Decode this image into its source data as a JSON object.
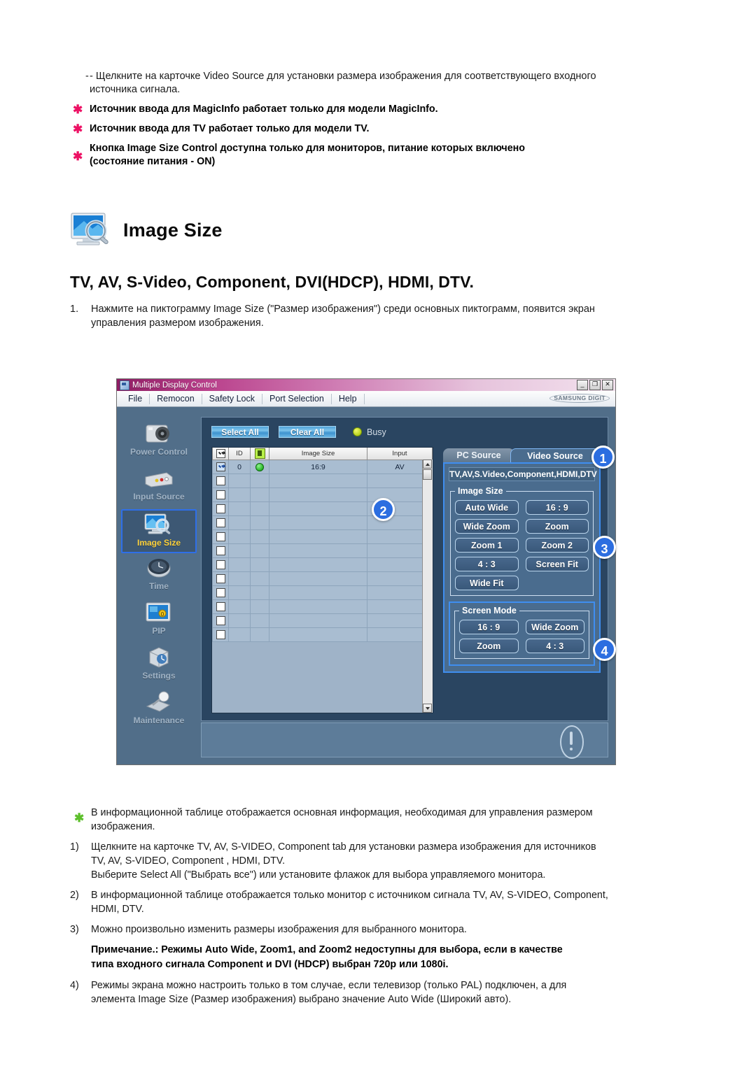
{
  "top_notes": {
    "dash_line_1": "- Щелкните на карточке Video Source для установки размера изображения для соответствующего входного",
    "dash_line_2": "источника сигнала.",
    "star_1": "Источник ввода для MagicInfo работает только для модели MagicInfo.",
    "star_2": "Источник ввода для TV работает только для модели TV.",
    "star_3_line1": "Кнопка Image Size Control доступна только для мониторов, питание которых включено",
    "star_3_line2": "(состояние питания - ON)"
  },
  "section": {
    "heading": "Image Size",
    "heading_icon": "monitor-magnifier-icon",
    "subheading": "TV, AV, S-Video, Component, DVI(HDCP), HDMI, DTV.",
    "step1_number": "1.",
    "step1_line1": "Нажмите на пиктограмму Image Size (\"Размер изображения\") среди основных пиктограмм, появится экран",
    "step1_line2": "управления размером изображения."
  },
  "app": {
    "title": "Multiple Display Control",
    "window_buttons": [
      "_",
      "❐",
      "✕"
    ],
    "menu": [
      "File",
      "Remocon",
      "Safety Lock",
      "Port Selection",
      "Help"
    ],
    "brand": "SAMSUNG DIGIT",
    "sidebar": [
      {
        "label": "Power Control",
        "icon": "power-control-icon",
        "active": false
      },
      {
        "label": "Input Source",
        "icon": "input-source-icon",
        "active": false
      },
      {
        "label": "Image Size",
        "icon": "image-size-icon",
        "active": true
      },
      {
        "label": "Time",
        "icon": "time-clock-icon",
        "active": false
      },
      {
        "label": "PIP",
        "icon": "pip-icon",
        "active": false
      },
      {
        "label": "Settings",
        "icon": "settings-cube-icon",
        "active": false
      },
      {
        "label": "Maintenance",
        "icon": "maintenance-icon",
        "active": false
      }
    ],
    "toolbar": {
      "select_all": "Select All",
      "clear_all": "Clear All",
      "busy_label": "Busy",
      "busy_icon": "busy-status-dot"
    },
    "table": {
      "headers": [
        "",
        "ID",
        "",
        "Image Size",
        "Input"
      ],
      "header_icons": [
        "header-checkbox",
        "power-state-icon"
      ],
      "rows": [
        {
          "checked": true,
          "id": "0",
          "status": "on",
          "image_size": "16:9",
          "input": "AV"
        },
        {
          "checked": false,
          "id": "",
          "status": "",
          "image_size": "",
          "input": ""
        },
        {
          "checked": false,
          "id": "",
          "status": "",
          "image_size": "",
          "input": ""
        },
        {
          "checked": false,
          "id": "",
          "status": "",
          "image_size": "",
          "input": ""
        },
        {
          "checked": false,
          "id": "",
          "status": "",
          "image_size": "",
          "input": ""
        },
        {
          "checked": false,
          "id": "",
          "status": "",
          "image_size": "",
          "input": ""
        },
        {
          "checked": false,
          "id": "",
          "status": "",
          "image_size": "",
          "input": ""
        },
        {
          "checked": false,
          "id": "",
          "status": "",
          "image_size": "",
          "input": ""
        },
        {
          "checked": false,
          "id": "",
          "status": "",
          "image_size": "",
          "input": ""
        },
        {
          "checked": false,
          "id": "",
          "status": "",
          "image_size": "",
          "input": ""
        },
        {
          "checked": false,
          "id": "",
          "status": "",
          "image_size": "",
          "input": ""
        },
        {
          "checked": false,
          "id": "",
          "status": "",
          "image_size": "",
          "input": ""
        },
        {
          "checked": false,
          "id": "",
          "status": "",
          "image_size": "",
          "input": ""
        }
      ]
    },
    "tabs": [
      {
        "label": "PC Source",
        "active": false
      },
      {
        "label": "Video Source",
        "active": true
      }
    ],
    "source_line": "TV,AV,S.Video,Component,HDMI,DTV",
    "image_size_group": {
      "legend": "Image Size",
      "buttons": [
        "Auto Wide",
        "16 : 9",
        "Wide Zoom",
        "Zoom",
        "Zoom 1",
        "Zoom 2",
        "4 : 3",
        "Screen Fit",
        "Wide Fit"
      ]
    },
    "screen_mode_group": {
      "legend": "Screen Mode",
      "buttons": [
        "16 : 9",
        "Wide Zoom",
        "Zoom",
        "4 : 3"
      ]
    },
    "badges": [
      "1",
      "2",
      "3",
      "4"
    ],
    "info_icon": "exclamation-mark-icon",
    "accent_color": "#2c6ee0",
    "highlight_color": "#ffd23a"
  },
  "bottom_notes": {
    "star_line1": "В информационной таблице отображается основная информация, необходимая для управления размером",
    "star_line2": "изображения.",
    "item1_num": "1)",
    "item1_line1": "Щелкните на карточке TV, AV, S-VIDEO, Component tab для установки размера изображения для источников",
    "item1_line2": "TV, AV, S-VIDEO, Component , HDMI, DTV.",
    "item1_line3": "Выберите Select All (\"Выбрать все\") или установите флажок для выбора управляемого монитора.",
    "item2_num": "2)",
    "item2_line1": "В информационной таблице отображается только монитор с источником сигнала TV, AV, S-VIDEO, Component,",
    "item2_line2": "HDMI, DTV.",
    "item3_num": "3)",
    "item3_line1": "Можно произвольно изменить размеры изображения для выбранного монитора.",
    "note_line1": "Примечание.: Режимы Auto Wide, Zoom1, and Zoom2 недоступны для выбора, если в качестве",
    "note_line2": "типа входного сигнала Component и DVI (HDCP) выбран 720p или 1080i.",
    "item4_num": "4)",
    "item4_line1": "Режимы экрана можно настроить только в том случае, если телевизор (только PAL) подключен, а для",
    "item4_line2": "элемента Image Size (Размер изображения) выбрано значение Auto Wide (Широкий авто)."
  }
}
